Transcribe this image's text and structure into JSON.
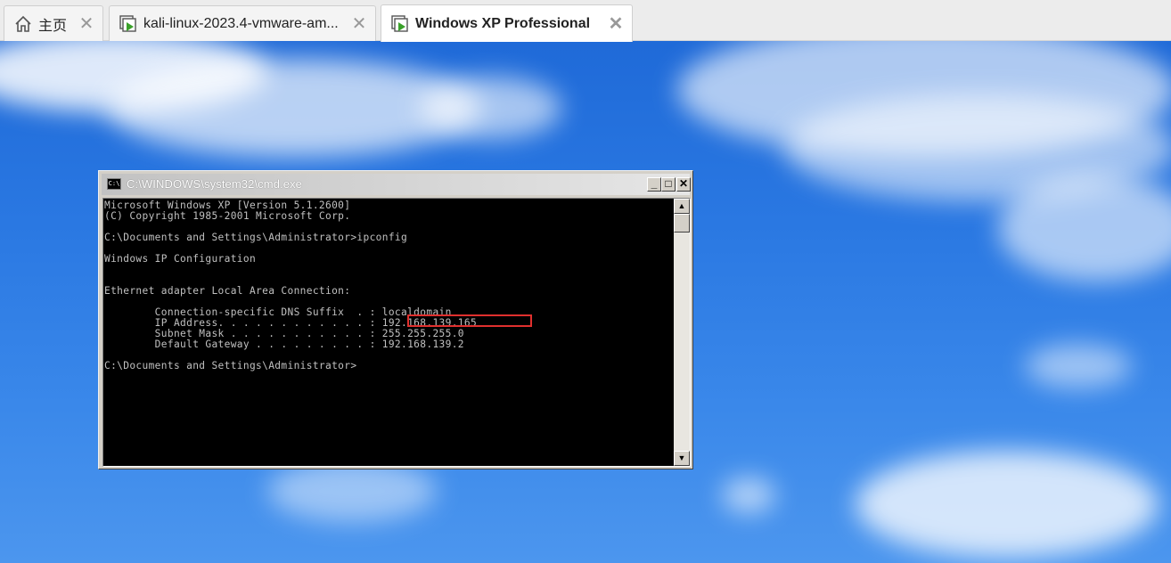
{
  "tabs": [
    {
      "label": "主页",
      "icon": "home-icon",
      "close": "✕"
    },
    {
      "label": "kali-linux-2023.4-vmware-am...",
      "icon": "vm-icon",
      "close": "✕"
    },
    {
      "label": "Windows XP Professional",
      "icon": "vm-icon",
      "close": "✕",
      "active": true
    }
  ],
  "cmd_window": {
    "title": "C:\\WINDOWS\\system32\\cmd.exe",
    "icon_text": "C:\\",
    "buttons": {
      "minimize": "_",
      "maximize": "□",
      "close": "✕"
    },
    "scroll": {
      "up": "▲",
      "down": "▼"
    },
    "console_lines": [
      "Microsoft Windows XP [Version 5.1.2600]",
      "(C) Copyright 1985-2001 Microsoft Corp.",
      "",
      "C:\\Documents and Settings\\Administrator>ipconfig",
      "",
      "Windows IP Configuration",
      "",
      "",
      "Ethernet adapter Local Area Connection:",
      "",
      "        Connection-specific DNS Suffix  . : localdomain",
      "        IP Address. . . . . . . . . . . . : 192.168.139.165",
      "        Subnet Mask . . . . . . . . . . . : 255.255.255.0",
      "        Default Gateway . . . . . . . . . : 192.168.139.2",
      "",
      "C:\\Documents and Settings\\Administrator>"
    ]
  },
  "colors": {
    "highlight": "#e0302e",
    "console_bg": "#000000",
    "console_fg": "#c0c0c0"
  }
}
